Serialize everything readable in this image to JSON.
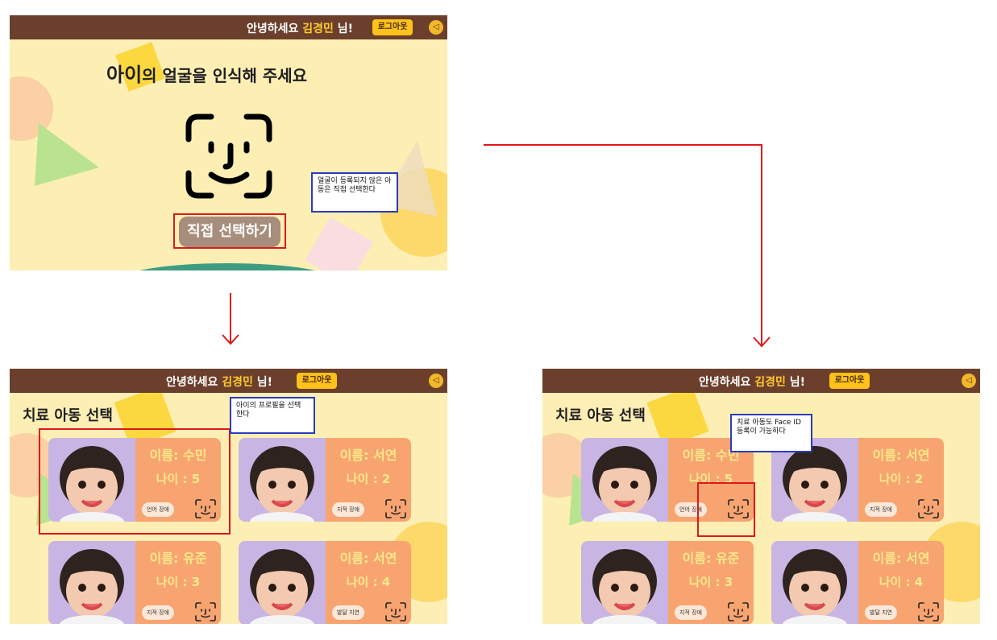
{
  "screens": {
    "face": {
      "greeting": {
        "prefix": "안녕하세요 ",
        "name": "김경민",
        "suffix": " 님!"
      },
      "logout": "로그아웃",
      "title_highlight": "아이",
      "title_rest": "의 얼굴을 인식해 주세요",
      "manual_button": "직접 선택하기",
      "speaker_icon": "speaker-icon"
    },
    "select_a": {
      "greeting": {
        "prefix": "안녕하세요 ",
        "name": "김경민",
        "suffix": " 님!"
      },
      "logout": "로그아웃",
      "title": "치료 아동 선택"
    },
    "select_b": {
      "greeting": {
        "prefix": "안녕하세요 ",
        "name": "김경민",
        "suffix": " 님!"
      },
      "logout": "로그아웃",
      "title": "치료 아동 선택"
    }
  },
  "children": [
    {
      "name": "이름: 수민",
      "age": "나이 : 5",
      "tag": "언어 장애"
    },
    {
      "name": "이름: 서연",
      "age": "나이 : 2",
      "tag": "지적 장애"
    },
    {
      "name": "이름: 유준",
      "age": "나이 : 3",
      "tag": "지적 장애"
    },
    {
      "name": "이름: 서연",
      "age": "나이 : 4",
      "tag": "발달 지연"
    }
  ],
  "notes": {
    "face": "얼굴이 등록되지 않은 아동은 직접 선택한다",
    "select_a": "아이의 프로필을 선택 한다",
    "select_b": "치료 아동도 Face ID 등록이 가능하다"
  },
  "colors": {
    "topbar": "#6b3f2c",
    "background": "#fdeeb4",
    "accent": "#ffc21a",
    "card_info": "#f7a471",
    "annotation_red": "#e0161c",
    "annotation_blue": "#2b3bbf"
  }
}
